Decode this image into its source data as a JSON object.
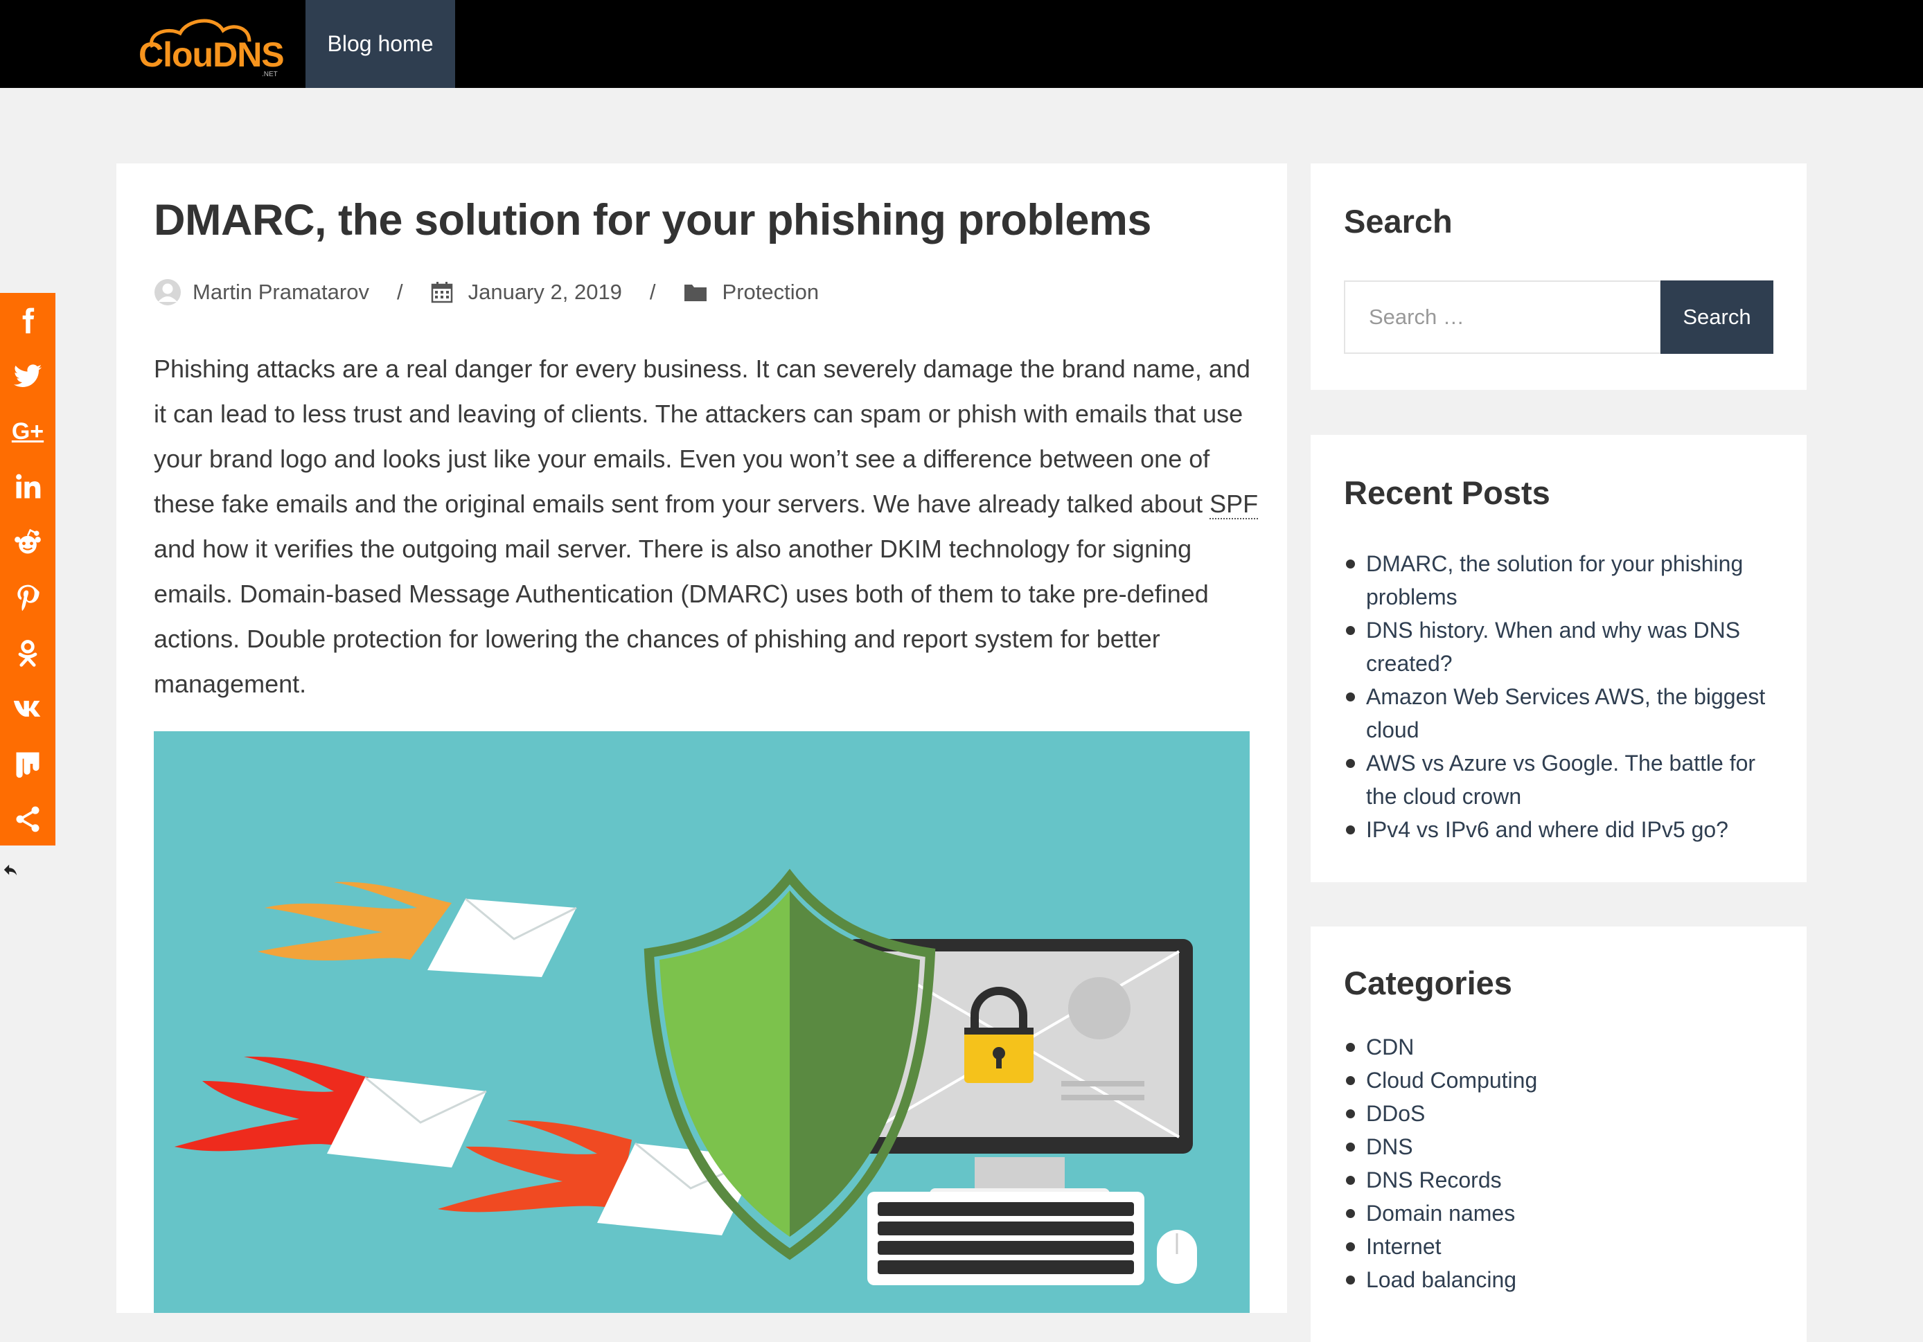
{
  "header": {
    "logo_text": "ClouDNS",
    "logo_suffix": ".NET",
    "nav": [
      {
        "label": "Blog home"
      }
    ],
    "colors": {
      "bar": "#000000",
      "nav_active": "#2f3e50",
      "logo": "#f7941d"
    }
  },
  "article": {
    "title": "DMARC, the solution for your phishing problems",
    "author": "Martin Pramatarov",
    "date": "January 2, 2019",
    "category": "Protection",
    "meta_separator": "/",
    "body_before_link": "Phishing attacks are a real danger for every business. It can severely damage the brand name, and it can lead to less trust and leaving of clients. The attackers can spam or phish with emails that use your brand logo and looks just like your emails. Even you won’t see a difference between one of these fake emails and the original emails sent from your servers. We have already talked about ",
    "body_link": "SPF",
    "body_after_link": " and how it verifies the outgoing mail server. There is also another DKIM technology for signing emails. Domain-based Message Authentication (DMARC) uses both of them to take pre-defined actions. Double protection for lowering the chances of phishing and report system for better management."
  },
  "sidebar": {
    "search": {
      "title": "Search",
      "placeholder": "Search …",
      "value": "",
      "button_label": "Search"
    },
    "recent": {
      "title": "Recent Posts",
      "items": [
        "DMARC, the solution for your phishing problems",
        "DNS history. When and why was DNS created?",
        "Amazon Web Services AWS, the biggest cloud",
        "AWS vs Azure vs Google. The battle for the cloud crown",
        "IPv4 vs IPv6 and where did IPv5 go?"
      ]
    },
    "categories": {
      "title": "Categories",
      "items": [
        "CDN",
        "Cloud Computing",
        "DDoS",
        "DNS",
        "DNS Records",
        "Domain names",
        "Internet",
        "Load balancing"
      ]
    }
  },
  "share_bar": {
    "color": "#fe6d02",
    "buttons": [
      "facebook-icon",
      "twitter-icon",
      "google-plus-icon",
      "linkedin-icon",
      "reddit-icon",
      "pinterest-icon",
      "odnoklassniki-icon",
      "vk-icon",
      "mix-icon",
      "share-icon"
    ],
    "google_plus_label": "G+"
  },
  "hero_image": {
    "colors": {
      "background": "#66c4c8",
      "shield_light": "#7cc24c",
      "shield_dark": "#5a8a41",
      "flames_red": "#ee2b1d",
      "flames_orange": "#f2a33a",
      "lock": "#f5c21b"
    }
  }
}
